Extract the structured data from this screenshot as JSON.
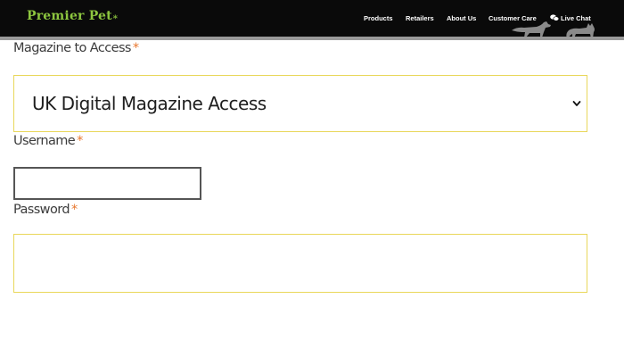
{
  "header": {
    "logo_text": "Premier Pet",
    "logo_mark": "∗",
    "nav": {
      "products": "Products",
      "retailers": "Retailers",
      "about_us": "About Us",
      "customer_care": "Customer Care",
      "live_chat": "Live Chat"
    },
    "colors": {
      "bar": "#0a0a0a",
      "logo": "#8dc63f",
      "nav_text": "#ffffff"
    }
  },
  "form": {
    "magazine": {
      "label": "Magazine to Access",
      "required_mark": "*",
      "selected_value": "UK Digital Magazine Access"
    },
    "username": {
      "label": "Username",
      "required_mark": "*",
      "value": ""
    },
    "password": {
      "label": "Password",
      "required_mark": "*",
      "value": ""
    },
    "colors": {
      "required": "#e8772e",
      "field_border": "#e9d75a"
    }
  }
}
